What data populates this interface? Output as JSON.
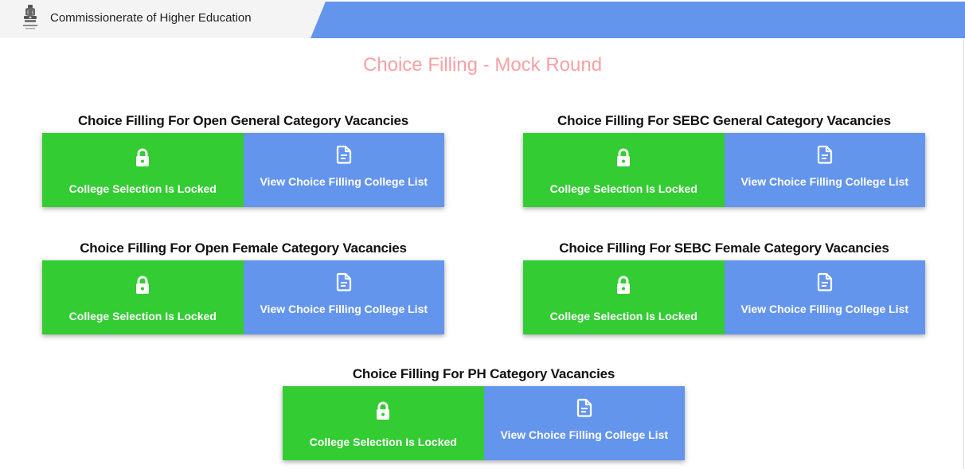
{
  "header": {
    "title": "Commissionerate of Higher Education",
    "logo_icon": "state-emblem-icon",
    "bar_color": "#6495ed"
  },
  "page_title": "Choice Filling - Mock Round",
  "colors": {
    "locked_tile": "#33cc33",
    "view_tile": "#6495ed",
    "page_title": "#f7a1a6"
  },
  "categories": [
    {
      "heading": "Choice Filling For Open General Category Vacancies",
      "locked_label": "College Selection Is Locked",
      "view_label": "View Choice Filling College List",
      "locked_icon": "lock-icon",
      "view_icon": "document-icon"
    },
    {
      "heading": "Choice Filling For SEBC General Category Vacancies",
      "locked_label": "College Selection Is Locked",
      "view_label": "View Choice Filling College List",
      "locked_icon": "lock-icon",
      "view_icon": "document-icon"
    },
    {
      "heading": "Choice Filling For Open Female Category Vacancies",
      "locked_label": "College Selection Is Locked",
      "view_label": "View Choice Filling College List",
      "locked_icon": "lock-icon",
      "view_icon": "document-icon"
    },
    {
      "heading": "Choice Filling For SEBC Female Category Vacancies",
      "locked_label": "College Selection Is Locked",
      "view_label": "View Choice Filling College List",
      "locked_icon": "lock-icon",
      "view_icon": "document-icon"
    },
    {
      "heading": "Choice Filling For PH Category Vacancies",
      "locked_label": "College Selection Is Locked",
      "view_label": "View Choice Filling College List",
      "locked_icon": "lock-icon",
      "view_icon": "document-icon"
    }
  ]
}
